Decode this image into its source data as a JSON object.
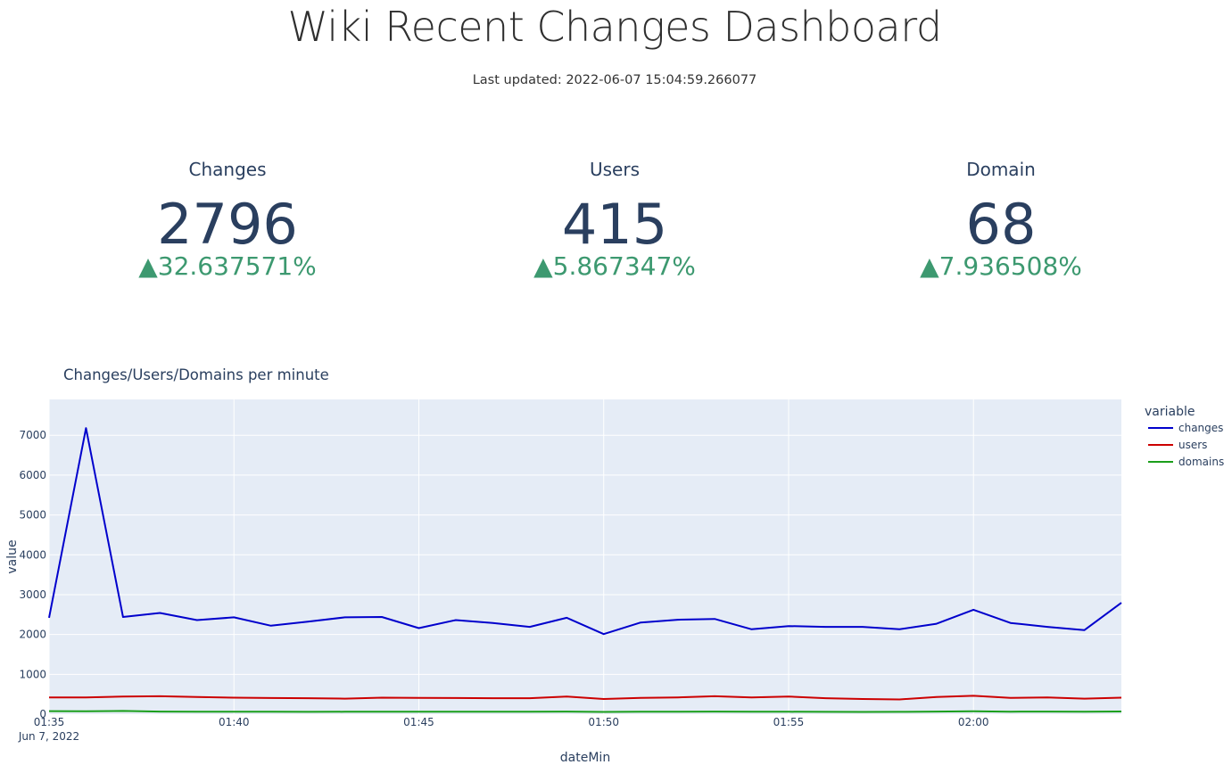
{
  "header": {
    "title": "Wiki Recent Changes Dashboard",
    "last_updated": "Last updated: 2022-06-07 15:04:59.266077"
  },
  "kpis": [
    {
      "label": "Changes",
      "value": "2796",
      "delta": "32.637571%",
      "arrow": "▲",
      "delta_color": "#3d9970"
    },
    {
      "label": "Users",
      "value": "415",
      "delta": "5.867347%",
      "arrow": "▲",
      "delta_color": "#3d9970"
    },
    {
      "label": "Domain",
      "value": "68",
      "delta": "7.936508%",
      "arrow": "▲",
      "delta_color": "#3d9970"
    }
  ],
  "chart_data": {
    "type": "line",
    "title": "Changes/Users/Domains per minute",
    "xlabel": "dateMin",
    "ylabel": "value",
    "x": [
      "01:35",
      "01:36",
      "01:37",
      "01:38",
      "01:39",
      "01:40",
      "01:41",
      "01:42",
      "01:43",
      "01:44",
      "01:45",
      "01:46",
      "01:47",
      "01:48",
      "01:49",
      "01:50",
      "01:51",
      "01:52",
      "01:53",
      "01:54",
      "01:55",
      "01:56",
      "01:57",
      "01:58",
      "01:59",
      "02:00",
      "02:01",
      "02:02",
      "02:03",
      "02:04"
    ],
    "x_ticks": [
      "01:35",
      "01:40",
      "01:45",
      "01:50",
      "01:55",
      "02:00"
    ],
    "x_date_label": "Jun 7, 2022",
    "y_ticks": [
      0,
      1000,
      2000,
      3000,
      4000,
      5000,
      6000,
      7000
    ],
    "ylim": [
      0,
      7900
    ],
    "grid": true,
    "background": "#e5ecf6",
    "legend": {
      "title": "variable",
      "placement": "right"
    },
    "series": [
      {
        "name": "changes",
        "color": "#0000cc",
        "values": [
          2420,
          7180,
          2440,
          2540,
          2360,
          2430,
          2220,
          2320,
          2430,
          2440,
          2160,
          2360,
          2290,
          2190,
          2420,
          2010,
          2300,
          2370,
          2390,
          2130,
          2210,
          2190,
          2190,
          2130,
          2270,
          2620,
          2290,
          2190,
          2110,
          2796
        ]
      },
      {
        "name": "users",
        "color": "#cc0000",
        "values": [
          420,
          420,
          440,
          450,
          430,
          415,
          405,
          400,
          390,
          415,
          410,
          405,
          400,
          400,
          440,
          380,
          410,
          420,
          450,
          420,
          440,
          400,
          380,
          370,
          430,
          460,
          410,
          420,
          390,
          415
        ]
      },
      {
        "name": "domains",
        "color": "#1a9e1a",
        "values": [
          75,
          72,
          80,
          65,
          60,
          62,
          60,
          58,
          60,
          62,
          60,
          62,
          63,
          60,
          64,
          55,
          60,
          63,
          66,
          62,
          60,
          58,
          55,
          58,
          64,
          72,
          62,
          65,
          60,
          68
        ]
      }
    ]
  }
}
